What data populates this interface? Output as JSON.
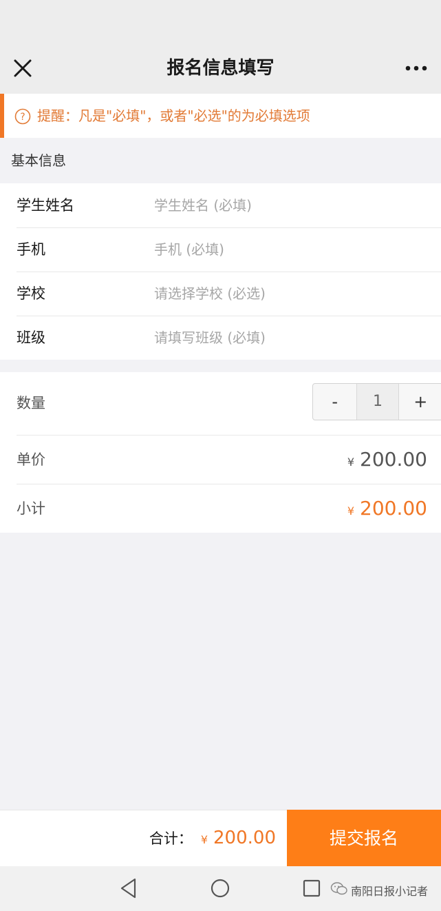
{
  "header": {
    "title": "报名信息填写",
    "close_icon": "close-icon",
    "more_icon": "more-icon"
  },
  "notice": {
    "text": "提醒：凡是\"必填\"，或者\"必选\"的为必填选项",
    "icon": "question-circle-icon",
    "color": "#e27a35"
  },
  "basic_info": {
    "title": "基本信息",
    "fields": [
      {
        "label": "学生姓名",
        "placeholder": "学生姓名 (必填)",
        "value": ""
      },
      {
        "label": "手机",
        "placeholder": "手机 (必填)",
        "value": ""
      },
      {
        "label": "学校",
        "placeholder": "请选择学校 (必选)",
        "value": ""
      },
      {
        "label": "班级",
        "placeholder": "请填写班级 (必填)",
        "value": ""
      }
    ]
  },
  "order": {
    "quantity": {
      "label": "数量",
      "minus": "-",
      "value": "1",
      "plus": "+"
    },
    "unit_price": {
      "label": "单价",
      "currency": "¥",
      "amount": "200.00"
    },
    "subtotal": {
      "label": "小计",
      "currency": "¥",
      "amount": "200.00"
    }
  },
  "footer": {
    "total_label": "合计：",
    "currency": "¥",
    "total_amount": "200.00",
    "submit_label": "提交报名"
  },
  "system_nav": {
    "back_icon": "back-triangle-icon",
    "home_icon": "home-circle-icon",
    "recents_icon": "recents-square-icon"
  },
  "watermark": {
    "text": "南阳日报小记者",
    "icon": "wechat-icon"
  },
  "colors": {
    "accent": "#f07726",
    "submit_bg": "#fe7e17",
    "background": "#f2f2f5"
  }
}
